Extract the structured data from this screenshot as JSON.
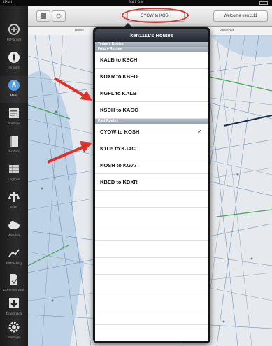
{
  "status_bar": {
    "carrier": "iPad",
    "time": "9:41 AM"
  },
  "toolbar": {
    "route_button_label": "CYOW to KOSH",
    "welcome_label": "Welcome ken1111"
  },
  "subbar": {
    "left_label": "Lowes",
    "right_label": "Weather"
  },
  "sidebar": {
    "items": [
      {
        "label": "FltPlanner",
        "icon": "flight-planner-icon"
      },
      {
        "label": "Airports",
        "icon": "airport-icon"
      },
      {
        "label": "Maps",
        "icon": "map-icon",
        "active": true
      },
      {
        "label": "Briefings",
        "icon": "briefing-icon"
      },
      {
        "label": "Binders",
        "icon": "binder-icon"
      },
      {
        "label": "Logbook",
        "icon": "logbook-icon"
      },
      {
        "label": "W&B",
        "icon": "weight-balance-icon"
      },
      {
        "label": "Weather",
        "icon": "weather-icon"
      },
      {
        "label": "FltTracking",
        "icon": "flight-tracking-icon"
      },
      {
        "label": "DocumentVault",
        "icon": "document-icon"
      },
      {
        "label": "Downloads",
        "icon": "download-icon"
      },
      {
        "label": "Settings",
        "icon": "settings-icon"
      }
    ]
  },
  "popover": {
    "title": "ken1111's Routes",
    "sections": {
      "today": "Today's Routes",
      "future": "Future Routes",
      "past": "Past Routes"
    },
    "future_routes": [
      "KALB to KSCH",
      "KDXR to KBED",
      "KGFL to KALB",
      "KSCH to KAGC"
    ],
    "past_routes": [
      "CYOW to KOSH",
      "K1C5 to KJAC",
      "KOSH to KG77",
      "KBED to KDXR"
    ],
    "checked_route": "CYOW to KOSH"
  },
  "colors": {
    "annotation_red": "#e0302a",
    "sidebar_bg": "#1f1f1f",
    "map_water": "#8fb6dc"
  }
}
